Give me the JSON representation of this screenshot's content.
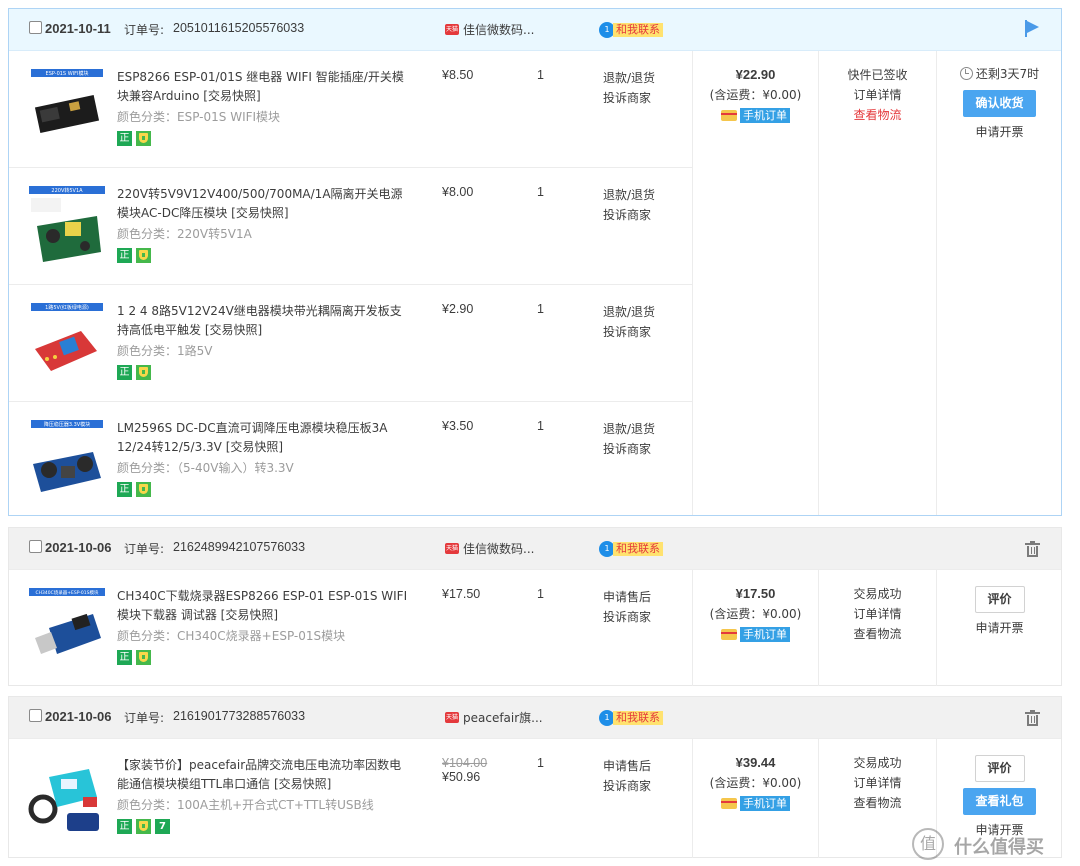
{
  "orders": [
    {
      "date": "2021-10-11",
      "order_no_label": "订单号:",
      "order_no": "2051011615205576033",
      "shop_badge": "天猫",
      "shop": "佳信微数码...",
      "contact_badge": "1",
      "contact": "和我联系",
      "items": [
        {
          "title": "ESP8266 ESP-01/01S 继电器 WIFI 智能插座/开关模块兼容Arduino",
          "snapshot": "[交易快照]",
          "sku": "颜色分类：ESP-01S WIFI模块",
          "badge_zheng": "正",
          "price": "¥8.50",
          "qty": "1",
          "aftersale1": "退款/退货",
          "aftersale2": "投诉商家",
          "thumb_label": "ESP-01S WIFI模块"
        },
        {
          "title": "220V转5V9V12V400/500/700MA/1A隔离开关电源模块AC-DC降压模块",
          "snapshot": "[交易快照]",
          "sku": "颜色分类：220V转5V1A",
          "badge_zheng": "正",
          "price": "¥8.00",
          "qty": "1",
          "aftersale1": "退款/退货",
          "aftersale2": "投诉商家",
          "thumb_label": "220V转5V1A"
        },
        {
          "title": "1 2 4 8路5V12V24V继电器模块带光耦隔离开发板支持高低电平触发",
          "snapshot": "[交易快照]",
          "sku": "颜色分类：1路5V",
          "badge_zheng": "正",
          "price": "¥2.90",
          "qty": "1",
          "aftersale1": "退款/退货",
          "aftersale2": "投诉商家",
          "thumb_label": "1路5V(红板绿电源)"
        },
        {
          "title": "LM2596S DC-DC直流可调降压电源模块稳压板3A 12/24转12/5/3.3V",
          "snapshot": "[交易快照]",
          "sku": "颜色分类：（5-40V输入）转3.3V",
          "badge_zheng": "正",
          "price": "¥3.50",
          "qty": "1",
          "aftersale1": "退款/退货",
          "aftersale2": "投诉商家",
          "thumb_label": "降压稳压器3.3V模块"
        }
      ],
      "pay_amount": "¥22.90",
      "pay_ship": "(含运费：¥0.00)",
      "pay_mobile": "手机订单",
      "status1": "快件已签收",
      "status2": "订单详情",
      "status3": "查看物流",
      "timer": "还剩3天7时",
      "op_primary": "确认收货",
      "op_link": "申请开票"
    },
    {
      "date": "2021-10-06",
      "order_no_label": "订单号:",
      "order_no": "2162489942107576033",
      "shop_badge": "天猫",
      "shop": "佳信微数码...",
      "contact_badge": "1",
      "contact": "和我联系",
      "items": [
        {
          "title": "CH340C下载烧录器ESP8266 ESP-01 ESP-01S WIFI模块下载器 调试器",
          "snapshot": "[交易快照]",
          "sku": "颜色分类：CH340C烧录器+ESP-01S模块",
          "badge_zheng": "正",
          "price": "¥17.50",
          "qty": "1",
          "aftersale1": "申请售后",
          "aftersale2": "投诉商家",
          "thumb_label": "CH340C烧录器+ESP-01S模块"
        }
      ],
      "pay_amount": "¥17.50",
      "pay_ship": "(含运费：¥0.00)",
      "pay_mobile": "手机订单",
      "status1": "交易成功",
      "status2": "订单详情",
      "status3": "查看物流",
      "op_primary": "评价",
      "op_link": "申请开票"
    },
    {
      "date": "2021-10-06",
      "order_no_label": "订单号:",
      "order_no": "2161901773288576033",
      "shop_badge": "天猫",
      "shop": "peacefair旗...",
      "contact_badge": "1",
      "contact": "和我联系",
      "items": [
        {
          "title": "【家装节价】peacefair品牌交流电压电流功率因数电能通信模块模组TTL串口通信",
          "snapshot": "[交易快照]",
          "sku": "颜色分类：100A主机+开合式CT+TTL转USB线",
          "badge_zheng": "正",
          "badge_seven": "7",
          "price_old": "¥104.00",
          "price": "¥50.96",
          "qty": "1",
          "aftersale1": "申请售后",
          "aftersale2": "投诉商家"
        }
      ],
      "pay_amount": "¥39.44",
      "pay_ship": "(含运费：¥0.00)",
      "pay_mobile": "手机订单",
      "status1": "交易成功",
      "status2": "订单详情",
      "status3": "查看物流",
      "op_primary": "评价",
      "op_secondary": "查看礼包",
      "op_link": "申请开票"
    }
  ],
  "watermark": "什么值得买",
  "watermark_icon": "值"
}
